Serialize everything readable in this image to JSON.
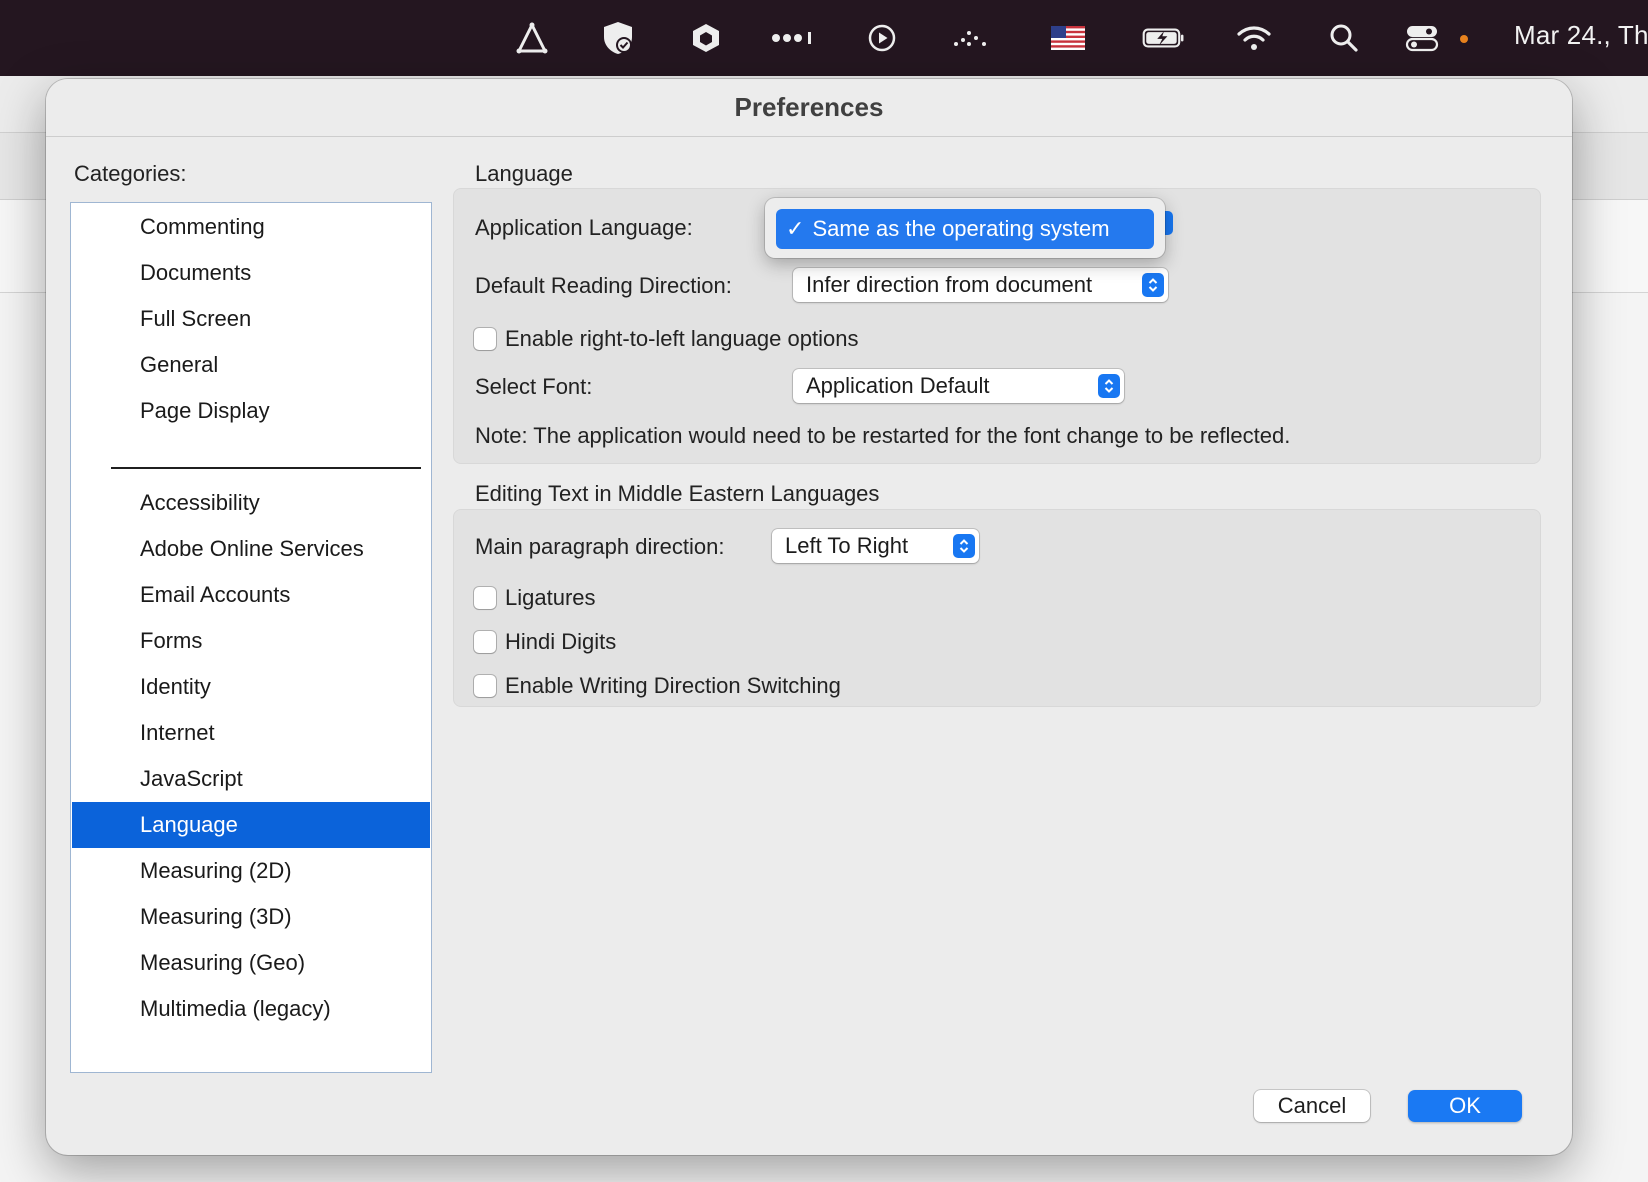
{
  "menubar": {
    "icons": [
      "delta-icon",
      "shield-check-icon",
      "box-icon",
      "dots-icon",
      "play-icon",
      "activity-icon",
      "us-flag-icon",
      "battery-charging-icon",
      "wifi-icon",
      "search-icon",
      "control-center-icon"
    ],
    "clock": "Mar 24., Th"
  },
  "dialog": {
    "title": "Preferences",
    "categories_label": "Categories:",
    "top_categories": [
      "Commenting",
      "Documents",
      "Full Screen",
      "General",
      "Page Display"
    ],
    "categories": [
      "Accessibility",
      "Adobe Online Services",
      "Email Accounts",
      "Forms",
      "Identity",
      "Internet",
      "JavaScript",
      "Language",
      "Measuring (2D)",
      "Measuring (3D)",
      "Measuring (Geo)",
      "Multimedia (legacy)"
    ],
    "selected_category": "Language",
    "language_section": {
      "title": "Language",
      "app_language_label": "Application Language:",
      "app_language_menu_item": "Same as the operating system",
      "check_glyph": "✓",
      "reading_direction_label": "Default Reading Direction:",
      "reading_direction_value": "Infer direction from document",
      "rtl_option_label": "Enable right-to-left language options",
      "rtl_option_checked": false,
      "font_label": "Select Font:",
      "font_value": "Application Default",
      "note": "Note: The application would need to be restarted for the font change to be reflected."
    },
    "middle_eastern_section": {
      "title": "Editing Text in Middle Eastern Languages",
      "paragraph_direction_label": "Main paragraph direction:",
      "paragraph_direction_value": "Left To Right",
      "ligatures_label": "Ligatures",
      "hindi_digits_label": "Hindi Digits",
      "writing_direction_label": "Enable Writing Direction Switching"
    },
    "buttons": {
      "cancel": "Cancel",
      "ok": "OK"
    }
  },
  "colors": {
    "accent": "#1a79f3",
    "selection": "#0b63da",
    "menubar": "#241620"
  }
}
